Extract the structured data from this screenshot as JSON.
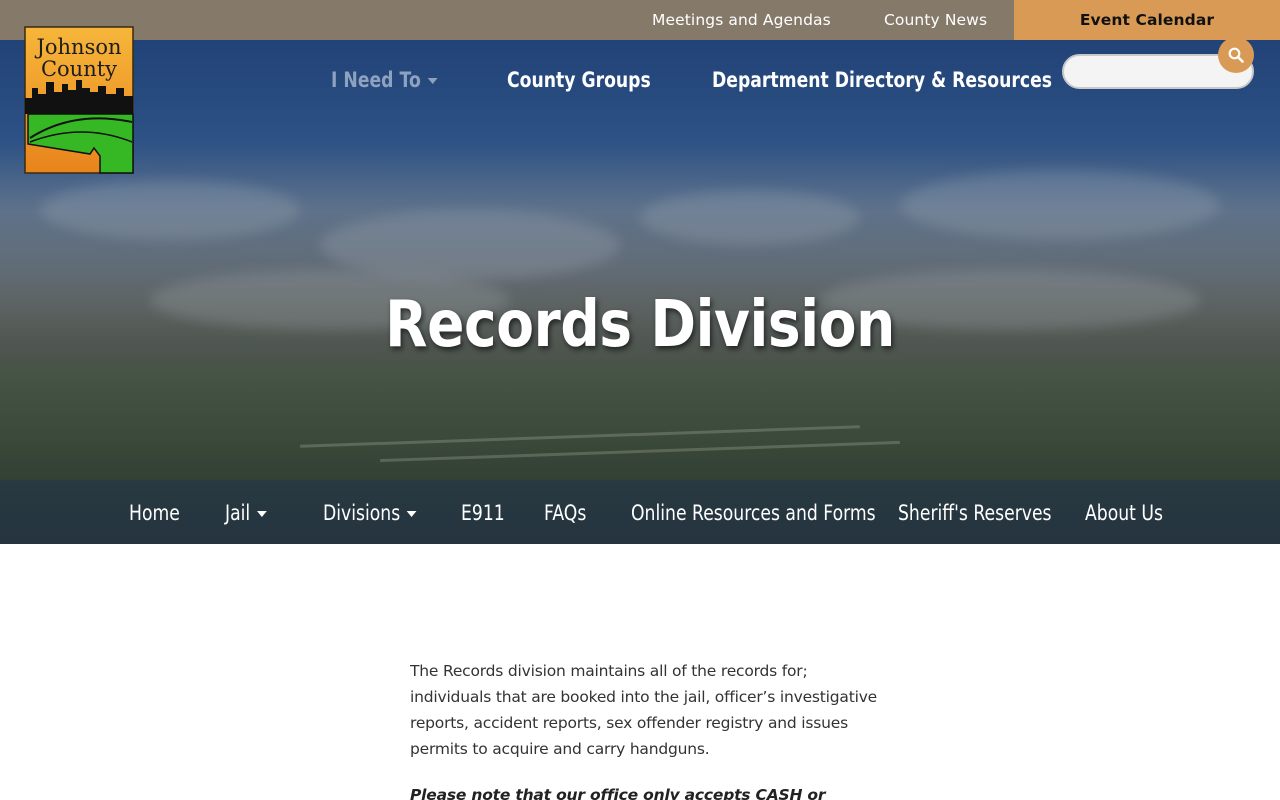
{
  "topbar": {
    "links": [
      {
        "label": "Meetings and Agendas"
      },
      {
        "label": "County News"
      },
      {
        "label": "Event Calendar"
      }
    ],
    "colors": {
      "bar": "#857a6a",
      "calendar": "#d99a55"
    }
  },
  "logo": {
    "line1": "Johnson",
    "line2": "County"
  },
  "mainnav": {
    "items": [
      {
        "label": "I Need To",
        "has_dropdown": true
      },
      {
        "label": "County Groups"
      },
      {
        "label": "Department Directory & Resources"
      }
    ]
  },
  "search": {
    "placeholder": "",
    "value": "",
    "icon": "search-icon"
  },
  "hero": {
    "title": "Records Division"
  },
  "subnav": {
    "items": [
      {
        "label": "Home"
      },
      {
        "label": "Jail",
        "has_dropdown": true
      },
      {
        "label": "Divisions",
        "has_dropdown": true
      },
      {
        "label": "E911"
      },
      {
        "label": "FAQs"
      },
      {
        "label": "Online Resources and Forms"
      },
      {
        "label": "Sheriff's Reserves"
      },
      {
        "label": "About Us"
      }
    ]
  },
  "content": {
    "intro": "The Records division maintains all of the records for; individuals that are booked into the jail, officer’s investigative reports, accident reports, sex offender registry and issues permits to acquire and carry handguns.",
    "note": "Please note that our office only accepts CASH or CHECK. An"
  }
}
